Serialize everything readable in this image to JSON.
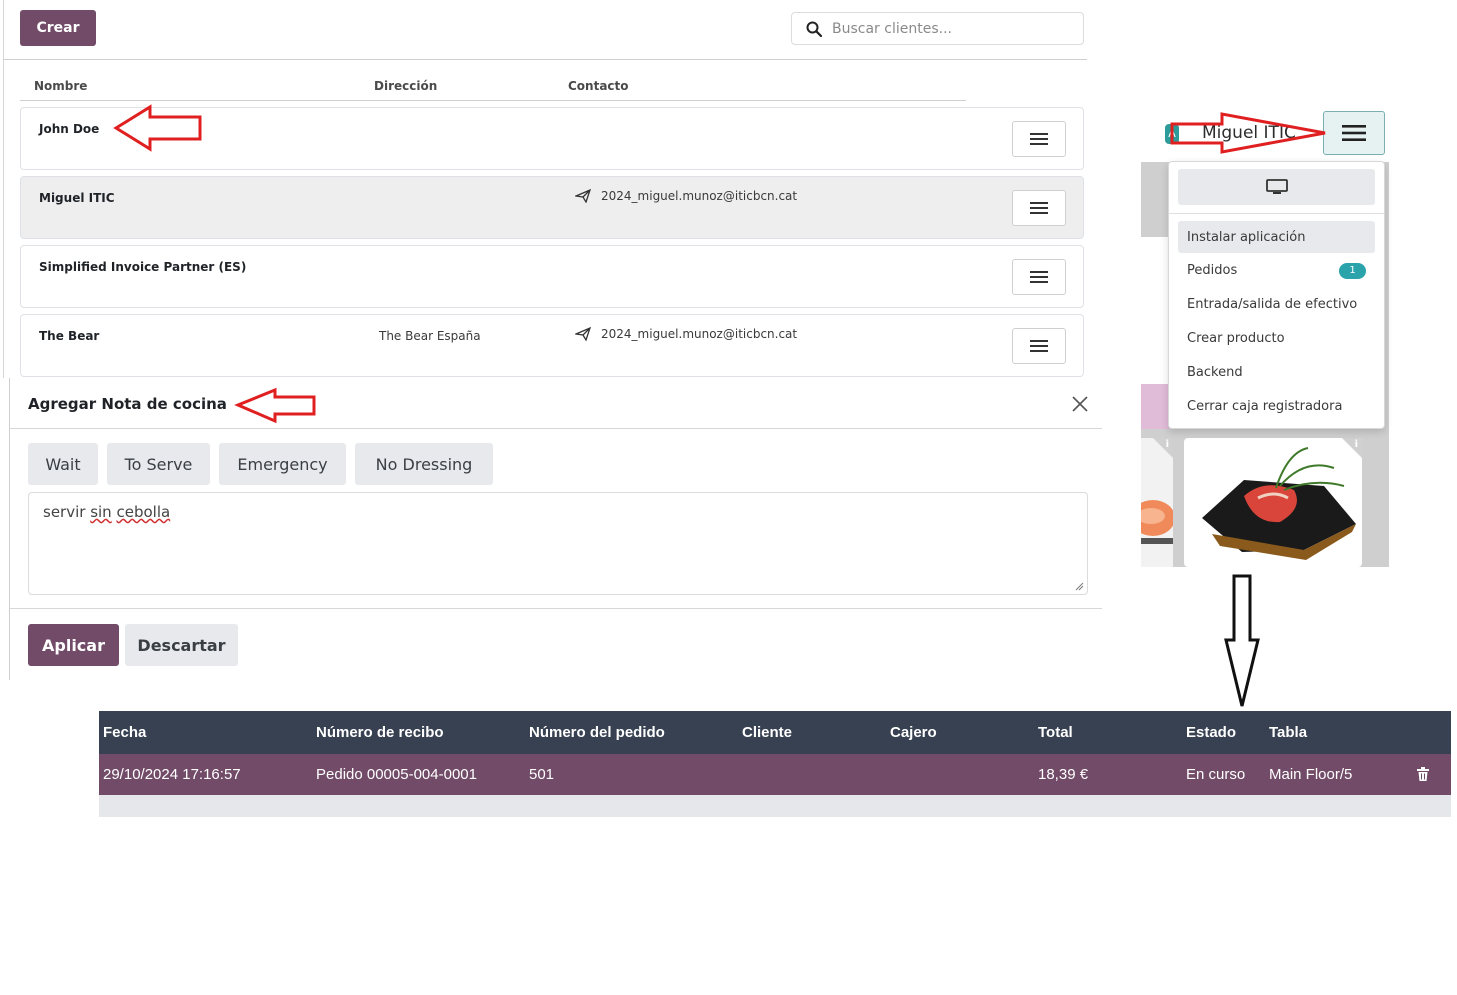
{
  "customer_list": {
    "create_label": "Crear",
    "search_placeholder": "Buscar clientes...",
    "columns": {
      "name": "Nombre",
      "address": "Dirección",
      "contact": "Contacto"
    },
    "customers": [
      {
        "name": "John Doe",
        "address": "",
        "email": ""
      },
      {
        "name": "Miguel ITIC",
        "address": "",
        "email": "2024_miguel.munoz@iticbcn.cat"
      },
      {
        "name": "Simplified Invoice Partner (ES)",
        "address": "",
        "email": ""
      },
      {
        "name": "The Bear",
        "address": "The Bear España",
        "email": "2024_miguel.munoz@iticbcn.cat"
      }
    ]
  },
  "kitchen_note": {
    "title": "Agregar Nota de cocina",
    "quick_tags": [
      "Wait",
      "To Serve",
      "Emergency",
      "No Dressing"
    ],
    "note_text_1": "servir ",
    "note_text_2": "sin",
    "note_text_3": " ",
    "note_text_4": "cebolla",
    "apply_label": "Aplicar",
    "discard_label": "Descartar"
  },
  "pos_header": {
    "user_badge": "A",
    "user_name": "Miguel ITIC"
  },
  "pos_menu": {
    "items": [
      {
        "label": "Instalar aplicación"
      },
      {
        "label": "Pedidos",
        "count": "1"
      },
      {
        "label": "Entrada/salida de efectivo"
      },
      {
        "label": "Crear producto"
      },
      {
        "label": "Backend"
      },
      {
        "label": "Cerrar caja registradora"
      }
    ]
  },
  "orders_table": {
    "headers": [
      "Fecha",
      "Número de recibo",
      "Número del pedido",
      "Cliente",
      "Cajero",
      "Total",
      "Estado",
      "Tabla"
    ],
    "rows": [
      {
        "date": "29/10/2024 17:16:57",
        "receipt": "Pedido 00005-004-0001",
        "order_number": "501",
        "customer": "",
        "cashier": "",
        "total": "18,39 €",
        "status": "En curso",
        "table": "Main Floor/5"
      }
    ]
  },
  "colors": {
    "primary": "#714b67",
    "table_header": "#374151",
    "badge": "#2aa3ab",
    "annotation": "#e02020"
  },
  "icons": [
    "search-icon",
    "send-icon",
    "menu-icon",
    "close-icon",
    "monitor-icon",
    "trash-icon",
    "info-icon"
  ]
}
